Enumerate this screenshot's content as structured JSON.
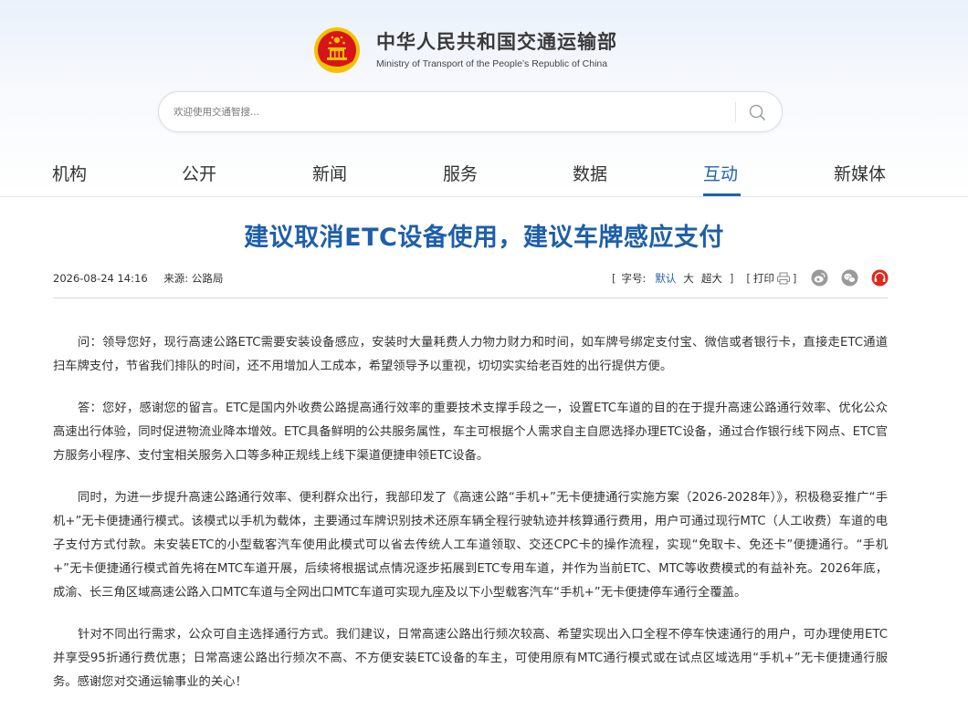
{
  "header": {
    "site_name_cn": "中华人民共和国交通运输部",
    "site_name_en": "Ministry of Transport of the People’s Republic of China"
  },
  "search": {
    "placeholder": "欢迎使用交通智搜..."
  },
  "nav": {
    "items": [
      {
        "label": "机构",
        "active": false
      },
      {
        "label": "公开",
        "active": false
      },
      {
        "label": "新闻",
        "active": false
      },
      {
        "label": "服务",
        "active": false
      },
      {
        "label": "数据",
        "active": false
      },
      {
        "label": "互动",
        "active": true
      },
      {
        "label": "新媒体",
        "active": false
      }
    ]
  },
  "article": {
    "title": "建议取消ETC设备使用，建议车牌感应支付",
    "date": "2026-08-24 14:16",
    "source": "来源: 公路局",
    "font_size_label": "字号:",
    "font_sizes": [
      "默认",
      "大",
      "超大"
    ],
    "print_label": "打印",
    "paragraphs": [
      "问：领导您好，现行高速公路ETC需要安装设备感应，安装时大量耗费人力物力财力和时间，如车牌号绑定支付宝、微信或者银行卡，直接走ETC通道扫车牌支付，节省我们排队的时间，还不用增加人工成本，希望领导予以重视，切切实实给老百姓的出行提供方便。",
      "答：您好，感谢您的留言。ETC是国内外收费公路提高通行效率的重要技术支撑手段之一，设置ETC车道的目的在于提升高速公路通行效率、优化公众高速出行体验，同时促进物流业降本增效。ETC具备鲜明的公共服务属性，车主可根据个人需求自主自愿选择办理ETC设备，通过合作银行线下网点、ETC官方服务小程序、支付宝相关服务入口等多种正规线上线下渠道便捷申领ETC设备。",
      "同时，为进一步提升高速公路通行效率、便利群众出行，我部印发了《高速公路“手机+”无卡便捷通行实施方案（2026-2028年）》，积极稳妥推广“手机+”无卡便捷通行模式。该模式以手机为载体，主要通过车牌识别技术还原车辆全程行驶轨迹并核算通行费用，用户可通过现行MTC（人工收费）车道的电子支付方式付款。未安装ETC的小型载客汽车使用此模式可以省去传统人工车道领取、交还CPC卡的操作流程，实现“免取卡、免还卡”便捷通行。“手机+”无卡便捷通行模式首先将在MTC车道开展，后续将根据试点情况逐步拓展到ETC专用车道，并作为当前ETC、MTC等收费模式的有益补充。2026年底，成渝、长三角区域高速公路入口MTC车道与全网出口MTC车道可实现九座及以下小型载客汽车“手机+”无卡便捷停车通行全覆盖。",
      "针对不同出行需求，公众可自主选择通行方式。我们建议，日常高速公路出行频次较高、希望实现出入口全程不停车快速通行的用户，可办理使用ETC并享受95折通行费优惠；日常高速公路出行频次不高、不方便安装ETC设备的车主，可使用原有MTC通行模式或在试点区域选用“手机+”无卡便捷通行服务。感谢您对交通运输事业的关心！"
    ]
  },
  "share": {
    "icons": [
      "weibo-icon",
      "wechat-icon",
      "douyin-icon"
    ]
  },
  "colors": {
    "accent_blue": "#1e63b0",
    "title_blue": "#1e5fa8",
    "emblem_red": "#d7141a",
    "emblem_gold": "#f2c200"
  }
}
